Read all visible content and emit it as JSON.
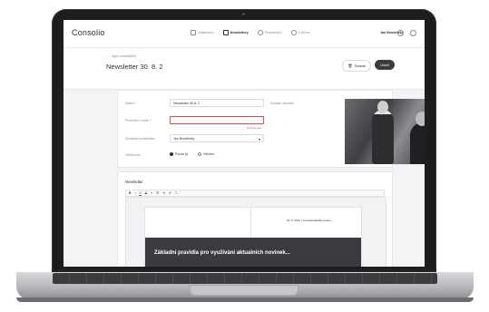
{
  "app": {
    "logo": "Consolio",
    "user_name": "Jan Brodehetý"
  },
  "nav": {
    "items": [
      {
        "label": "Dashboard",
        "icon": "grid-icon"
      },
      {
        "label": "Newslettery",
        "icon": "newsletter-icon",
        "active": true
      },
      {
        "label": "Prezentující",
        "icon": "users-icon"
      },
      {
        "label": "e-Strom",
        "icon": "link-icon"
      }
    ]
  },
  "header": {
    "back_label": "←  Výpis newsletterů",
    "title": "Newsletter 30. 8. 2",
    "delete_label": "Smazat",
    "save_label": "Uložit"
  },
  "form": {
    "name_label": "Název *",
    "name_value": "Newsletter 30.8. 2",
    "image_label": "Kutriání obrázek",
    "subject_label": "Předmět e-mailu *",
    "subject_value": "",
    "subject_error": "Povinné pole",
    "editor_label": "Redaktor/redaktorka",
    "editor_value": "Jan Brodehetý",
    "visibility_label": "Viditelnost",
    "visibility_options": [
      "Pouze já",
      "Všichni"
    ],
    "visibility_selected": 0
  },
  "newsletter": {
    "section_title": "Newsletter",
    "toolbar": [
      "B",
      "I",
      "U",
      "S",
      "≡",
      "☰",
      "⟲",
      "⟳",
      "Tₓ"
    ],
    "mail_date": "30. 8. 2022  |  Consolio/aktu8reonaion",
    "mail_heading": "Základní pravidla pro využívání aktualních novinek..."
  },
  "colors": {
    "primary_dark": "#3a3b3e",
    "error": "#d04a4a",
    "muted_text": "#8a8d93"
  }
}
